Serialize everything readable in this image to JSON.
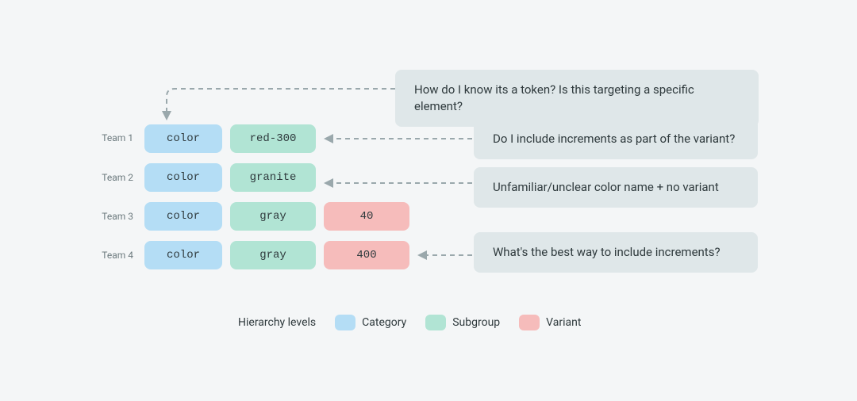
{
  "teams": [
    {
      "label": "Team 1"
    },
    {
      "label": "Team 2"
    },
    {
      "label": "Team 3"
    },
    {
      "label": "Team 4"
    }
  ],
  "rows": [
    {
      "category": "color",
      "subgroup": "red-300",
      "variant": null
    },
    {
      "category": "color",
      "subgroup": "granite",
      "variant": null
    },
    {
      "category": "color",
      "subgroup": "gray",
      "variant": "40"
    },
    {
      "category": "color",
      "subgroup": "gray",
      "variant": "400"
    }
  ],
  "callouts": {
    "top": "How do I know its a token? Is this targeting a specific element?",
    "variant_increments": "Do I include increments as part of the variant?",
    "unclear_name": "Unfamiliar/unclear color name + no variant",
    "best_increments": "What's the best way to include increments?"
  },
  "legend": {
    "title": "Hierarchy levels",
    "items": [
      {
        "label": "Category",
        "color": "#b4ddf5"
      },
      {
        "label": "Subgroup",
        "color": "#b1e4d4"
      },
      {
        "label": "Variant",
        "color": "#f6bcbb"
      }
    ]
  }
}
